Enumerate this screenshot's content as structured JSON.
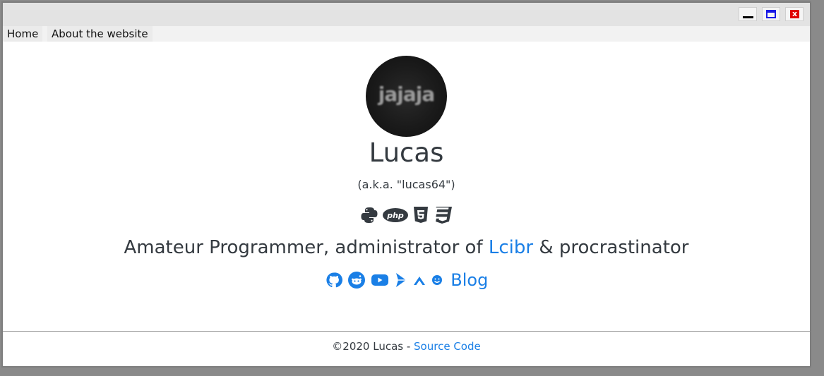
{
  "window": {
    "controls": [
      "minimize-icon",
      "maximize-icon",
      "close-icon"
    ],
    "close_glyph": "x"
  },
  "menu": {
    "home": "Home",
    "about": "About the website"
  },
  "profile": {
    "avatar_text": "jajaja",
    "name": "Lucas",
    "aka": "(a.k.a. \"lucas64\")",
    "tech_icons": [
      "python-icon",
      "php-icon",
      "html5-icon",
      "css3-icon"
    ],
    "tagline_prefix": "Amateur Programmer, administrator of ",
    "tagline_link": "Lcibr",
    "tagline_suffix": " & procrastinator",
    "social_icons": [
      "github-icon",
      "reddit-icon",
      "youtube-icon",
      "play-arrow-icon",
      "mountain-icon",
      "smile-icon"
    ],
    "blog_label": "Blog"
  },
  "footer": {
    "copyright": "©2020 Lucas - ",
    "source_link": "Source Code"
  },
  "colors": {
    "text": "#343a40",
    "link": "#1a7fe6",
    "titlebar": "#e3e3e3"
  }
}
